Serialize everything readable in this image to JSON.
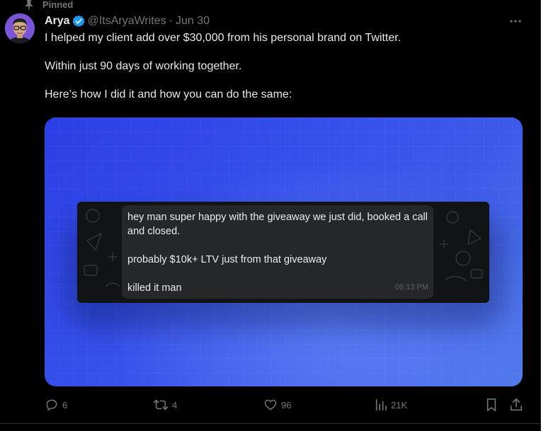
{
  "pinned_label": "Pinned",
  "author": {
    "name": "Arya",
    "handle": "@ItsAryaWrites",
    "separator": "·",
    "date": "Jun 30"
  },
  "tweet": {
    "paragraphs": [
      "I helped my client add over $30,000 from his personal brand on Twitter.",
      "Within just 90 days of working together.",
      "Here’s how I did it and how you can do the same:"
    ]
  },
  "media": {
    "message_paragraphs": [
      "hey man super happy with the giveaway we just did, booked a call and closed.",
      "probably $10k+ LTV just from that giveaway",
      "killed it man"
    ],
    "message_time": "05:13 PM"
  },
  "actions": {
    "replies": "6",
    "reposts": "4",
    "likes": "96",
    "views": "21K"
  },
  "colors": {
    "background": "#000000",
    "text": "#e7e9ea",
    "muted": "#71767b",
    "verified": "#1d9bf0",
    "media_blue": "#3550ea"
  }
}
